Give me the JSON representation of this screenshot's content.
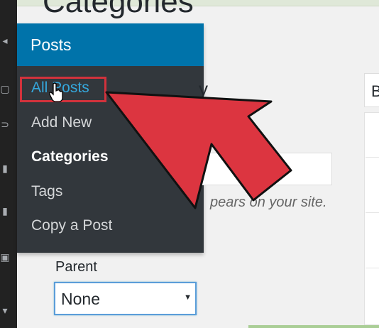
{
  "page": {
    "title": "Categories"
  },
  "sidebar": {
    "section_label": "Posts",
    "items": [
      {
        "label": "All Posts",
        "state": "hovered"
      },
      {
        "label": "Add New",
        "state": "normal"
      },
      {
        "label": "Categories",
        "state": "current"
      },
      {
        "label": "Tags",
        "state": "normal"
      },
      {
        "label": "Copy a Post",
        "state": "normal"
      }
    ]
  },
  "form": {
    "heading_fragment": "y",
    "help_fragment": "pears on your site.",
    "parent_label": "Parent",
    "parent_value": "None"
  },
  "right_column": {
    "button_fragment": "B"
  },
  "annotation": {
    "arrow_color": "#dc3540",
    "box_color": "#d2323c"
  },
  "colors": {
    "accent": "#0073aa",
    "menu_bg": "#32373c",
    "hover_link": "#35a8dd"
  }
}
